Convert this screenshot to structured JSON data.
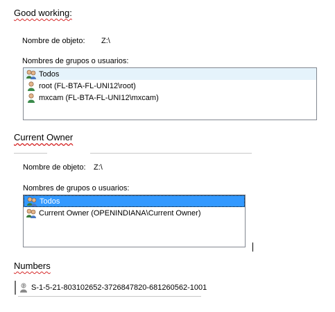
{
  "section1": {
    "heading": "Good working:",
    "object_label": "Nombre de objeto:",
    "object_value": "Z:\\",
    "groups_label": "Nombres de grupos o usuarios:",
    "items": [
      {
        "label": "Todos",
        "icon": "group-icon"
      },
      {
        "label": "root (FL-BTA-FL-UNI12\\root)",
        "icon": "user-icon"
      },
      {
        "label": "mxcam (FL-BTA-FL-UNI12\\mxcam)",
        "icon": "user-icon"
      }
    ]
  },
  "section2": {
    "heading": "Current Owner",
    "object_label": "Nombre de objeto:",
    "object_value": "Z:\\",
    "groups_label": "Nombres de grupos o usuarios:",
    "items": [
      {
        "label": "Todos",
        "icon": "group-icon",
        "selected": true
      },
      {
        "label": "Current Owner (OPENINDIANA\\Current Owner)",
        "icon": "group-icon"
      }
    ]
  },
  "section3": {
    "heading": "Numbers",
    "items": [
      {
        "label": "S-1-5-21-803102652-3726847820-681260562-1001",
        "icon": "unknown-user-icon"
      }
    ]
  },
  "colors": {
    "selection": "#3399ff",
    "spellcheck": "#d62828",
    "listbox_border": "#828790"
  }
}
